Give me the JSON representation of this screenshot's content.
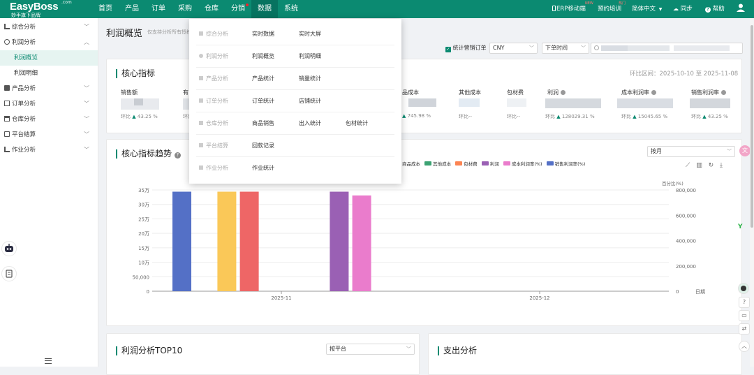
{
  "app": {
    "logo": "EasyBoss",
    "logo_sub": "妙手旗下品牌",
    "logo_com": ".com"
  },
  "nav": [
    "首页",
    "产品",
    "订单",
    "采购",
    "仓库",
    "分销",
    "数据",
    "系统"
  ],
  "nav_active": "数据",
  "topright": {
    "erp": "ERP移动端",
    "erp_badge": "NEW",
    "training": "预约培训",
    "training_badge": "热门",
    "lang": "简体中文",
    "sync": "同步",
    "help": "帮助"
  },
  "sidebar": {
    "groups": [
      {
        "label": "综合分析",
        "expanded": false
      },
      {
        "label": "利润分析",
        "expanded": true,
        "children": [
          "利润概览",
          "利润明细"
        ],
        "active": "利润概览"
      },
      {
        "label": "产品分析",
        "expanded": false
      },
      {
        "label": "订单分析",
        "expanded": false
      },
      {
        "label": "仓库分析",
        "expanded": false
      },
      {
        "label": "平台结算",
        "expanded": false
      },
      {
        "label": "作业分析",
        "expanded": false
      }
    ]
  },
  "page": {
    "title": "利润概览",
    "subtitle": "仅支持分析所有授权"
  },
  "filters": {
    "checkbox_label": "统计营销订单",
    "currency": "CNY",
    "time_type": "下单时间"
  },
  "core": {
    "title": "核心指标",
    "range": "环比区间：2025-10-10 至 2025-11-08",
    "kpis": [
      {
        "label": "销售额",
        "ratio": "43.25 %",
        "up": true
      },
      {
        "label": "有",
        "ratio": "",
        "up": false
      },
      {
        "label": "品成本",
        "ratio": "745.98 %",
        "up": true
      },
      {
        "label": "其他成本",
        "ratio": "--",
        "up": false
      },
      {
        "label": "包材费",
        "ratio": "--",
        "up": false
      },
      {
        "label": "利润",
        "ratio": "128029.31 %",
        "up": true
      },
      {
        "label": "成本利润率",
        "ratio": "15045.65 %",
        "up": true
      },
      {
        "label": "销售利润率",
        "ratio": "43.25 %",
        "up": true
      }
    ],
    "ratio_prefix": "环比"
  },
  "trend": {
    "title": "核心指标趋势",
    "period": "按月",
    "legend": [
      {
        "name": "商品成本",
        "color": "#ee6666"
      },
      {
        "name": "其他成本",
        "color": "#3ba272"
      },
      {
        "name": "包材费",
        "color": "#fc8452"
      },
      {
        "name": "利润",
        "color": "#9a60b4"
      },
      {
        "name": "成本利润率(%)",
        "color": "#ea7ccc"
      },
      {
        "name": "销售利润率(%)",
        "color": "#5470c6"
      }
    ],
    "y_right_label": "百分比(%)",
    "x_axis_label": "日期"
  },
  "chart_data": {
    "type": "bar",
    "categories": [
      "2025-11",
      "2025-12"
    ],
    "ylim": [
      0,
      350000
    ],
    "y_ticks": [
      "0",
      "50,000",
      "10万",
      "15万",
      "20万",
      "25万",
      "30万",
      "35万"
    ],
    "y2lim": [
      0,
      800000
    ],
    "y2_ticks": [
      "0",
      "200,000",
      "400,000",
      "600,000",
      "800,000"
    ],
    "series": [
      {
        "color": "#5470c6",
        "values": [
          344000,
          0
        ]
      },
      {
        "color": "#fac858",
        "values": [
          344000,
          0
        ]
      },
      {
        "color": "#ee6666",
        "values": [
          344000,
          0
        ]
      },
      {
        "name": "利润",
        "color": "#9a60b4",
        "values": [
          344000,
          0
        ]
      },
      {
        "name": "成本利润率(%)",
        "color": "#ea7ccc",
        "values": [
          331000,
          0
        ]
      }
    ],
    "grid": true,
    "legend_position": "top-right"
  },
  "top10": {
    "title": "利润分析TOP10",
    "select": "按平台"
  },
  "expense": {
    "title": "支出分析"
  },
  "dropdown": {
    "rows": [
      {
        "cat": "综合分析",
        "items": [
          "实时数据",
          "实时大屏"
        ]
      },
      {
        "cat": "利润分析",
        "items": [
          "利润概览",
          "利润明细"
        ]
      },
      {
        "cat": "产品分析",
        "items": [
          "产品统计",
          "销量统计"
        ]
      },
      {
        "cat": "订单分析",
        "items": [
          "订单统计",
          "店铺统计"
        ]
      },
      {
        "cat": "仓库分析",
        "items": [
          "商品销售",
          "出入统计",
          "包材统计"
        ]
      },
      {
        "cat": "平台结算",
        "items": [
          "回款记录"
        ]
      },
      {
        "cat": "作业分析",
        "items": [
          "作业统计"
        ]
      }
    ]
  }
}
